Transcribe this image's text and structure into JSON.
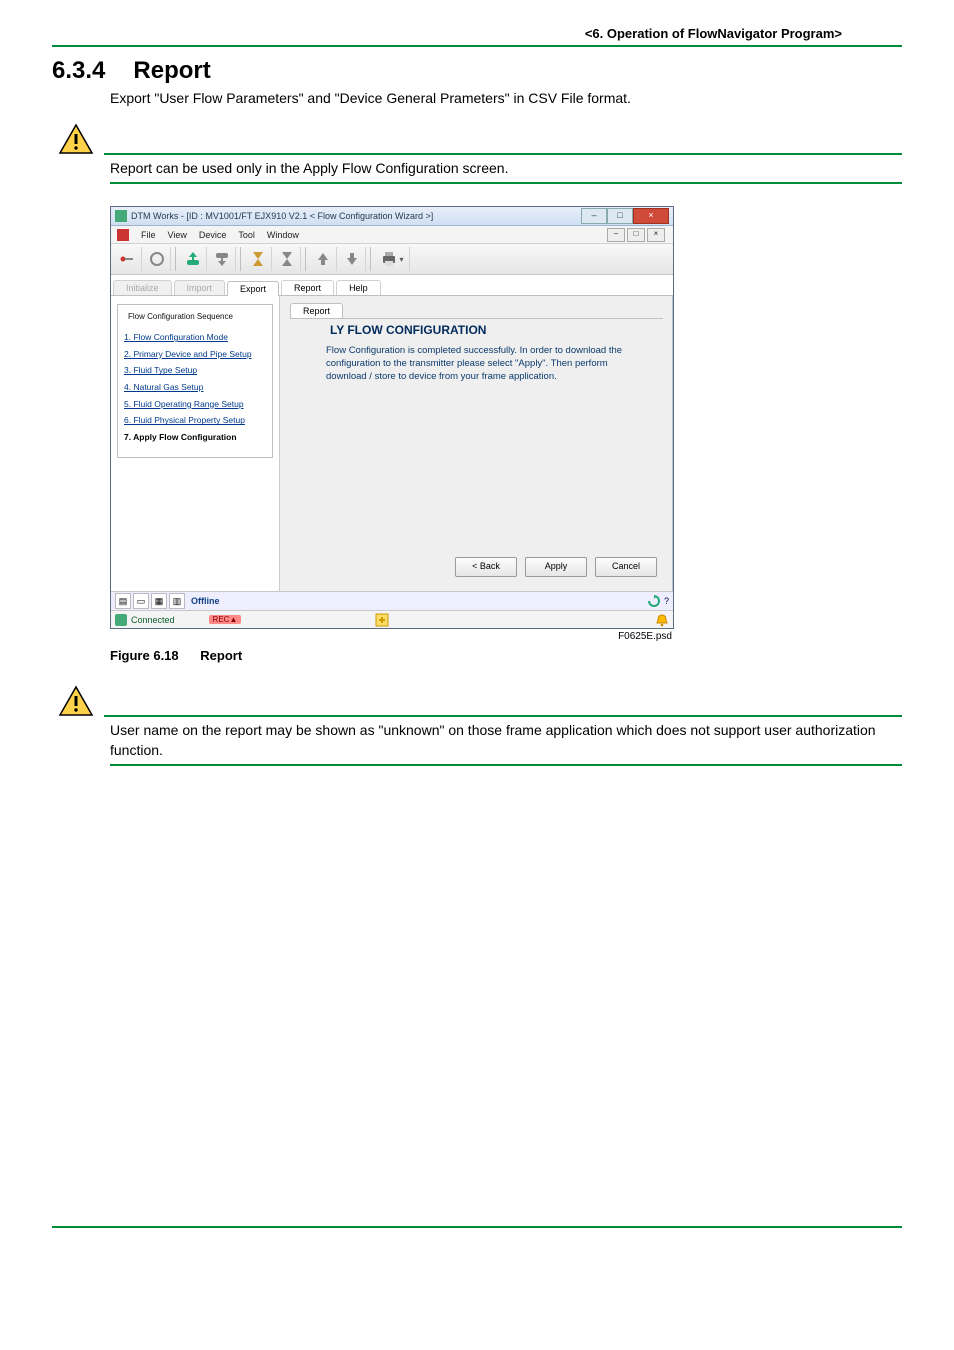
{
  "header": {
    "chapter": "<6.  Operation of FlowNavigator Program>"
  },
  "section": {
    "number": "6.3.4",
    "title": "Report"
  },
  "intro_text": "Export \"User Flow Parameters\" and \"Device General Prameters\" in CSV File format.",
  "note1_text": "Report can be used only in the Apply Flow Configuration screen.",
  "note2_text": "User name on the report may be shown as \"unknown\" on those frame application which does not support user authorization function.",
  "figure": {
    "label": "Figure 6.18",
    "title": "Report",
    "psd": "F0625E.psd"
  },
  "screenshot": {
    "window_title": "DTM Works - [ID : MV1001/FT EJX910 V2.1 < Flow Configuration Wizard >]",
    "menubar": [
      "File",
      "View",
      "Device",
      "Tool",
      "Window"
    ],
    "main_tabs": {
      "items": [
        "Initialize",
        "Import",
        "Export",
        "Report",
        "Help"
      ],
      "active_index": 2
    },
    "sidebar": {
      "group_title": "Flow Configuration Sequence",
      "steps": [
        "1. Flow Configuration Mode",
        "2. Primary Device and Pipe Setup",
        "3. Fluid Type Setup",
        "4. Natural Gas Setup",
        "5. Fluid Operating Range Setup",
        "6. Fluid Physical Property Setup",
        "7. Apply Flow Configuration"
      ],
      "active_step_index": 6
    },
    "content": {
      "inner_tab": "Report",
      "title": "LY FLOW CONFIGURATION",
      "message": "Flow Configuration is completed successfully. In order to download the configuration to the transmitter please select \"Apply\". Then perform download / store to device from your frame application."
    },
    "buttons": {
      "back": "< Back",
      "apply": "Apply",
      "cancel": "Cancel"
    },
    "status": {
      "mode": "Offline",
      "help_mark": "?",
      "connected": "Connected"
    }
  }
}
